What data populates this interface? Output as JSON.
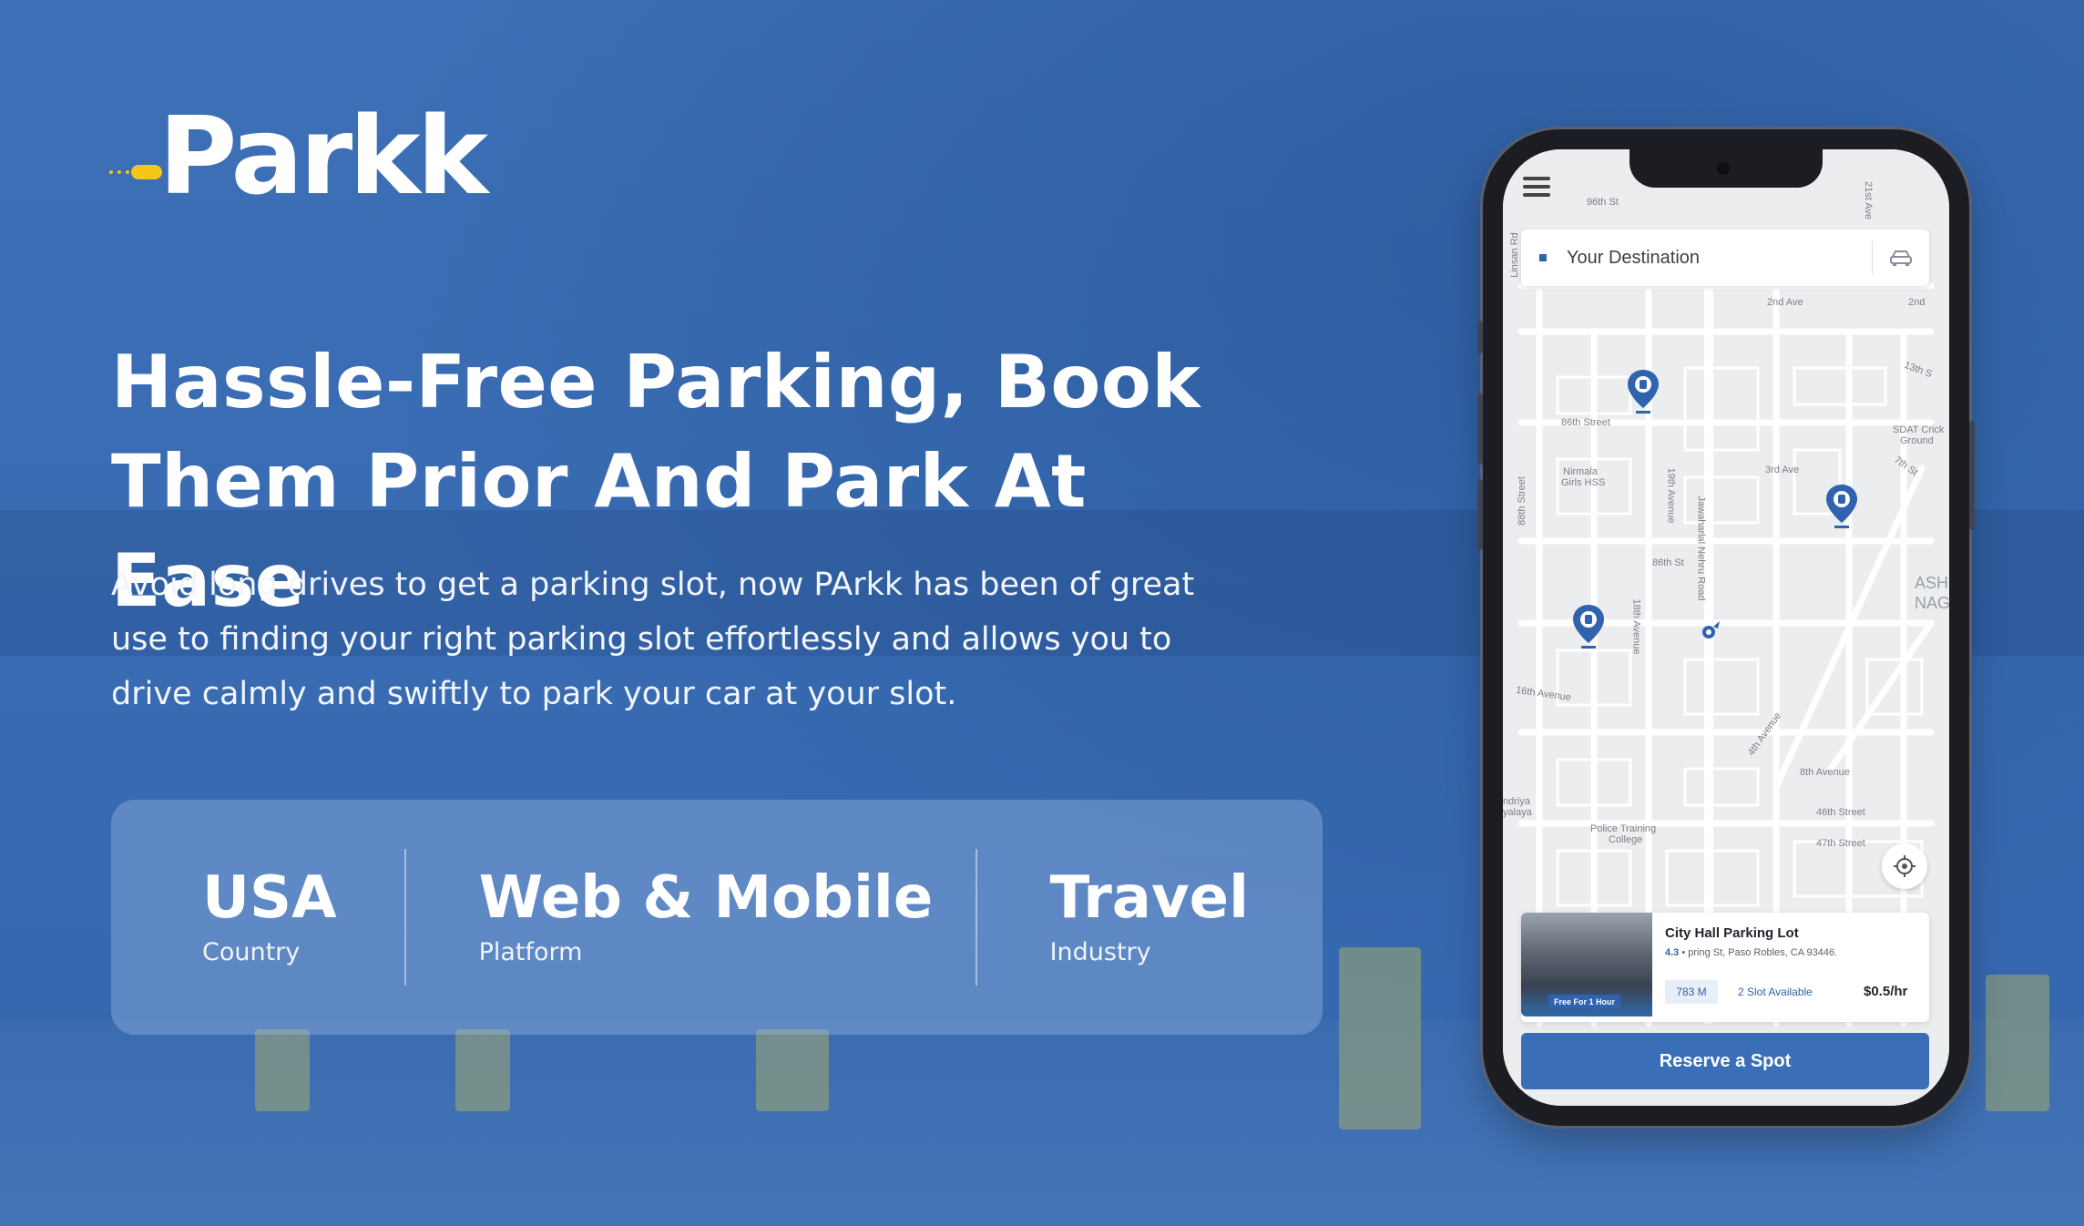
{
  "brand": {
    "name": "Parkk"
  },
  "hero": {
    "headline_line1": "Hassle-Free Parking, Book",
    "headline_line2": "Them Prior And Park At Ease",
    "description": "Avoid long drives to get a parking slot, now PArkk has been of great use to finding your right parking slot effortlessly and allows you to drive calmly and swiftly to park your car at your slot."
  },
  "stats": [
    {
      "value": "USA",
      "label": "Country"
    },
    {
      "value": "Web & Mobile",
      "label": "Platform"
    },
    {
      "value": "Travel",
      "label": "Industry"
    }
  ],
  "app": {
    "search_placeholder": "Your Destination",
    "map_labels": {
      "l96th": "96th St",
      "l2nd": "2nd Ave",
      "l2nd_b": "2nd",
      "l13th": "13th S",
      "l86th": "86th Street",
      "lsdat": "SDAT Crick",
      "lground": "Ground",
      "l7th": "7th St",
      "l3rd": "3rd Ave",
      "lnirmala": "Nirmala",
      "lgirls": "Girls HSS",
      "l88th": "88th Street",
      "l19th": "19th Avenue",
      "ljnr": "Jawaharlal Nehru Road",
      "l86thst": "86th St",
      "lash": "ASH",
      "lnag": "NAG",
      "l18th": "18th Avenue",
      "l16th": "16th Avenue",
      "l4th": "4th Avenue",
      "l8th": "8th Avenue",
      "lndriya": "ndriya",
      "lyalaya": "yalaya",
      "l46th": "46th Street",
      "l47th": "47th Street",
      "lpolice": "Police Training",
      "lcollege": "College",
      "llinsan": "Linsan Rd",
      "l21st": "21st Ave"
    },
    "lot": {
      "name": "City Hall Parking Lot",
      "rating": "4.3",
      "address": " • pring St, Paso Robles, CA 93446.",
      "distance": "783 M",
      "slots": "2 Slot Available",
      "price": "$0.5/hr",
      "badge": "Free For 1 Hour"
    },
    "reserve_label": "Reserve a Spot"
  },
  "colors": {
    "background": "#3a6db3",
    "accent": "#3a6fb8",
    "logo_car": "#f5c518"
  }
}
